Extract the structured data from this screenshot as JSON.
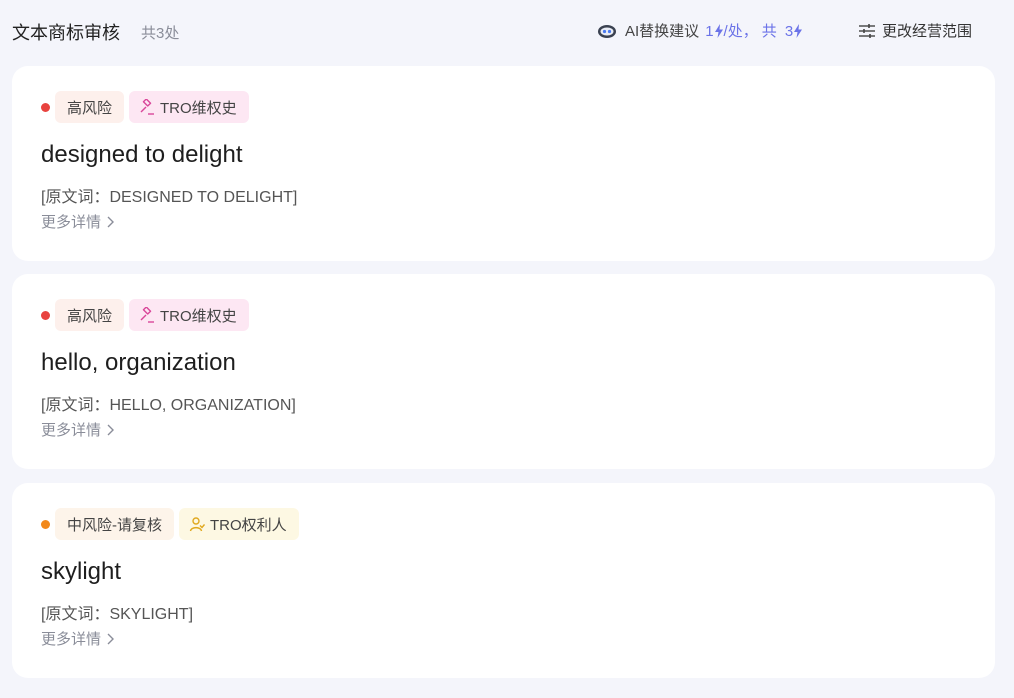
{
  "header": {
    "title": "文本商标审核",
    "count": "共3处",
    "ai_label": "AI替换建议",
    "ai_cost_num": "1",
    "ai_cost_unit": "/处，",
    "ai_total_prefix": "共",
    "ai_total_num": "3",
    "change_label": "更改经营范围"
  },
  "colors": {
    "high_risk": "#e8433f",
    "mid_risk": "#f2891b",
    "accent": "#6b73e8",
    "pink_icon": "#d9479a",
    "yellow_icon": "#e0a81e"
  },
  "cards": [
    {
      "risk": "高风险",
      "tro_tag": "TRO维权史",
      "tro_icon": "gavel-icon",
      "word": "designed to delight",
      "original": "[原文词：DESIGNED TO DELIGHT]",
      "more": "更多详情"
    },
    {
      "risk": "高风险",
      "tro_tag": "TRO维权史",
      "tro_icon": "gavel-icon",
      "word": "hello, organization",
      "original": "[原文词：HELLO, ORGANIZATION]",
      "more": "更多详情"
    },
    {
      "risk": "中风险-请复核",
      "tro_tag": "TRO权利人",
      "tro_icon": "person-icon",
      "word": "skylight",
      "original": "[原文词：SKYLIGHT]",
      "more": "更多详情"
    }
  ]
}
